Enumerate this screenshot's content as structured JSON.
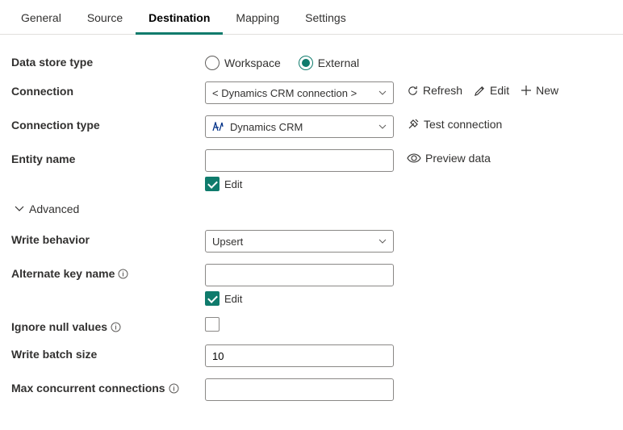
{
  "tabs": {
    "general": "General",
    "source": "Source",
    "destination": "Destination",
    "mapping": "Mapping",
    "settings": "Settings"
  },
  "fields": {
    "data_store_type": {
      "label": "Data store type",
      "workspace": "Workspace",
      "external": "External"
    },
    "connection": {
      "label": "Connection",
      "value": "< Dynamics CRM connection >",
      "refresh": "Refresh",
      "edit": "Edit",
      "new": "New"
    },
    "connection_type": {
      "label": "Connection type",
      "value": "Dynamics CRM",
      "test": "Test connection"
    },
    "entity_name": {
      "label": "Entity name",
      "value": "",
      "preview": "Preview data",
      "edit_label": "Edit"
    },
    "advanced_label": "Advanced",
    "write_behavior": {
      "label": "Write behavior",
      "value": "Upsert"
    },
    "alternate_key_name": {
      "label": "Alternate key name",
      "value": "",
      "edit_label": "Edit"
    },
    "ignore_null_values": {
      "label": "Ignore null values"
    },
    "write_batch_size": {
      "label": "Write batch size",
      "value": "10"
    },
    "max_concurrent_connections": {
      "label": "Max concurrent connections",
      "value": ""
    }
  }
}
